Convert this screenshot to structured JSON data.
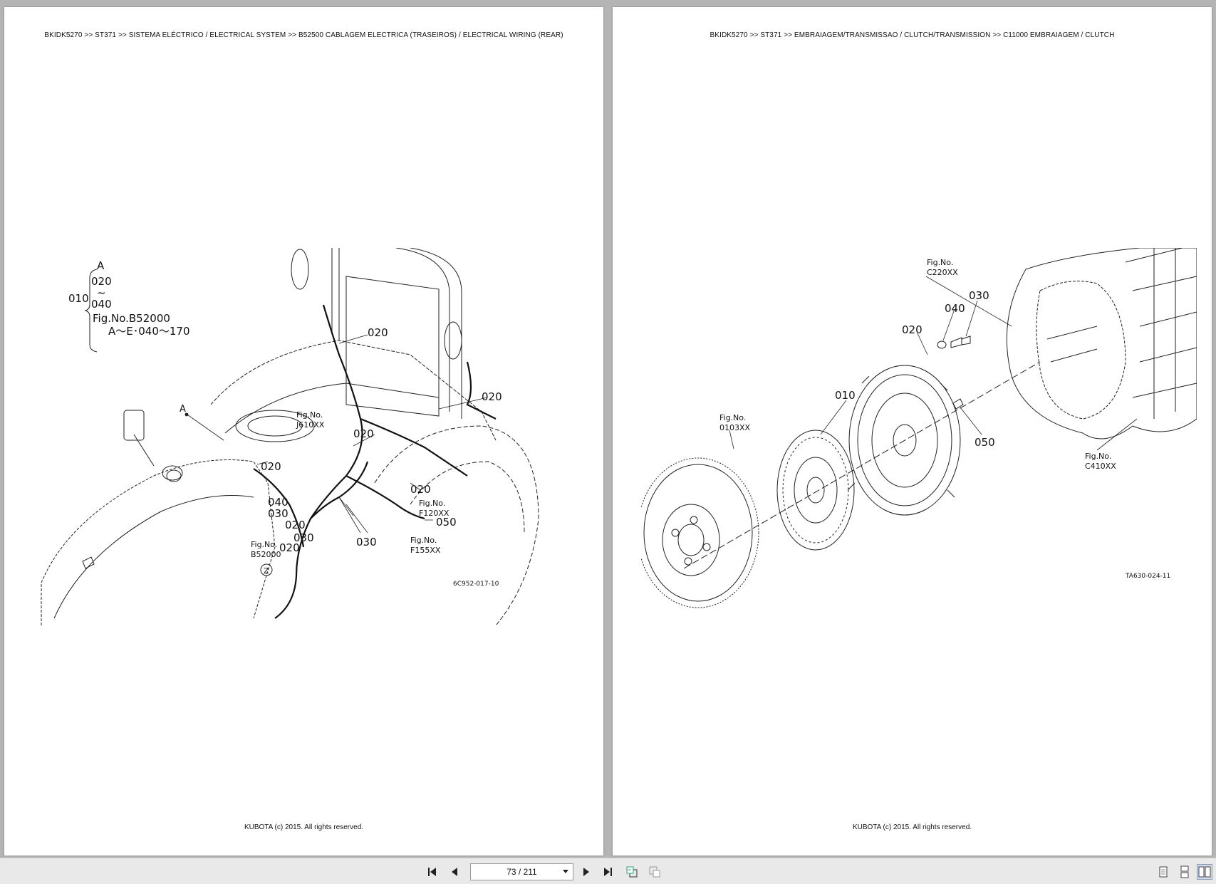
{
  "left_page": {
    "breadcrumb": "BKIDK5270 >> ST371 >> SISTEMA ELÉCTRICO / ELECTRICAL SYSTEM >> B52500   CABLAGEM ELECTRICA (TRASEIROS) / ELECTRICAL WIRING (REAR)",
    "footer": "KUBOTA (c) 2015. All rights reserved.",
    "drawing_code": "6C952-017-10",
    "callouts": {
      "a_top": "A",
      "r020": "020",
      "r040": "040",
      "r010": "010",
      "fig_b52000_line": "Fig.No.B52000",
      "range": "A～E･040～170",
      "a_point": "A",
      "c020_top": "020",
      "c020_right": "020",
      "c020_mid": "020",
      "c020_left": "020",
      "c020_lower": "020",
      "c040": "040",
      "c030a": "030",
      "c020b": "020",
      "c030b": "030",
      "c020c": "020",
      "c030c": "030",
      "c050": "050",
      "fig_j610_label": "Fig.No.",
      "fig_j610_code": "J610XX",
      "fig_f120_label": "Fig.No.",
      "fig_f120_code": "F120XX",
      "fig_f155_label": "Fig.No.",
      "fig_f155_code": "F155XX",
      "fig_b52000_label": "Fig.No.",
      "fig_b52000_code": "B52000",
      "z": "Z"
    }
  },
  "right_page": {
    "breadcrumb": "BKIDK5270 >> ST371 >> EMBRAIAGEM/TRANSMISSAO / CLUTCH/TRANSMISSION >> C11000   EMBRAIAGEM / CLUTCH",
    "footer": "KUBOTA (c) 2015. All rights reserved.",
    "drawing_code": "TA630-024-11",
    "callouts": {
      "fig_c220_label": "Fig.No.",
      "fig_c220_code": "C220XX",
      "c030": "030",
      "c040": "040",
      "c020": "020",
      "c010": "010",
      "fig_0103_label": "Fig.No.",
      "fig_0103_code": "0103XX",
      "c050": "050",
      "fig_c410_label": "Fig.No.",
      "fig_c410_code": "C410XX"
    }
  },
  "toolbar": {
    "page_indicator": "73 / 211",
    "icons": [
      "first-page-icon",
      "prev-page-icon",
      "next-page-icon",
      "last-page-icon",
      "go-back-view-icon",
      "go-forward-view-icon",
      "single-page-view-icon",
      "continuous-view-icon",
      "facing-pages-view-icon"
    ]
  }
}
